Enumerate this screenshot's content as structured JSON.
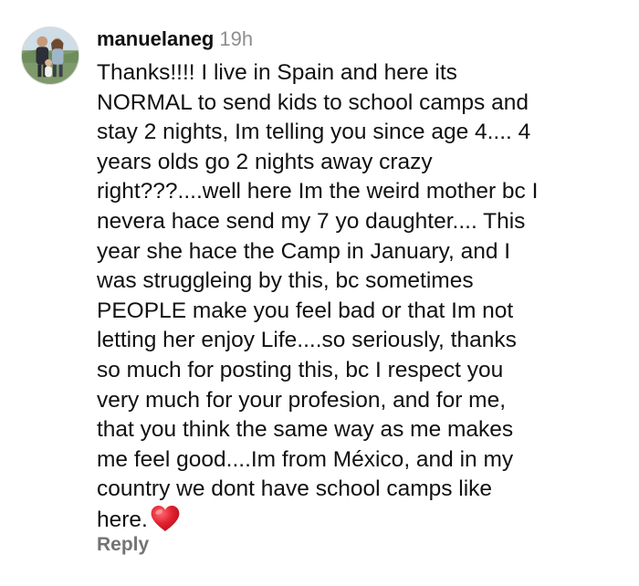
{
  "comment": {
    "username": "manuelaneg",
    "time": "19h",
    "lines": [
      "Thanks!!!! I live in Spain and here its",
      "NORMAL to send kids to school camps and",
      "stay 2 nights, Im telling you since age 4.... 4",
      "years olds go 2 nights away crazy",
      "right???....well here Im the weird mother bc I",
      "nevera hace send my 7 yo daughter.... This",
      "year she hace the Camp in January, and I",
      "was struggleing by this, bc sometimes",
      "PEOPLE make you feel bad or that Im not",
      "letting her enjoy Life....so seriously, thanks",
      "so much for posting this, bc I respect you",
      "very much for your profesion, and for me,",
      "that you think the same way as me makes",
      "me feel good....Im from México, and in my",
      "country we dont have school camps like",
      "here."
    ],
    "end_emoji": "red-heart-icon",
    "reply_label": "Reply"
  },
  "colors": {
    "username": "#111111",
    "timestamp": "#8e8e8e",
    "reply": "#737373",
    "heart": "#e0202e"
  }
}
